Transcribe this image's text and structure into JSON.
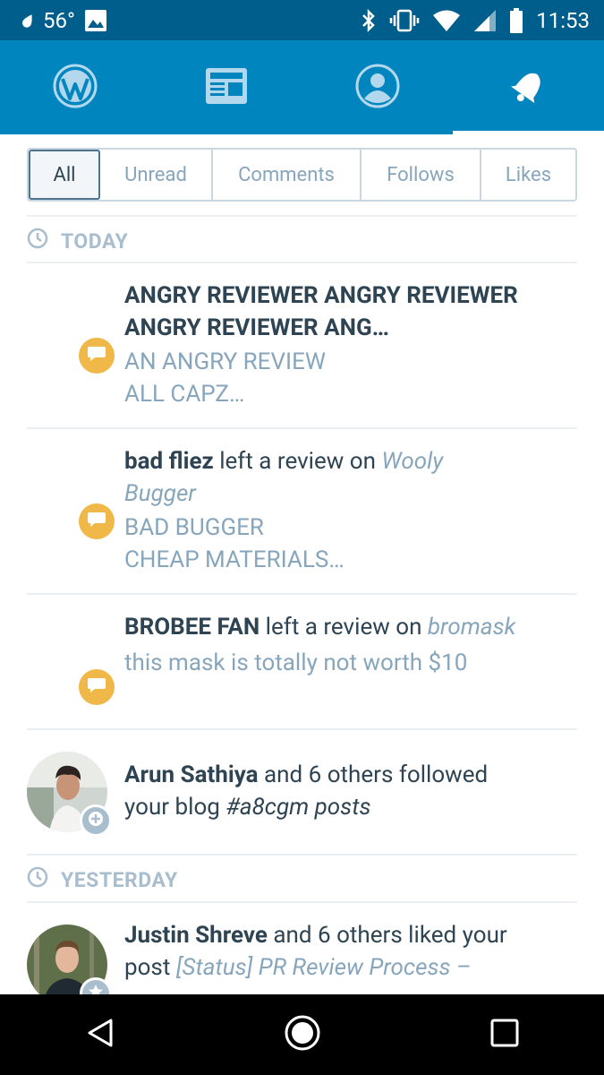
{
  "status_bar": {
    "temperature": "56°",
    "time": "11:53",
    "icons": [
      "drop-icon",
      "image-icon",
      "bluetooth-icon",
      "vibrate-icon",
      "wifi-icon",
      "signal-icon",
      "battery-icon"
    ]
  },
  "top_nav": {
    "tabs": [
      {
        "icon": "wordpress-icon",
        "active": false
      },
      {
        "icon": "reader-icon",
        "active": false
      },
      {
        "icon": "profile-icon",
        "active": false
      },
      {
        "icon": "notifications-bell-icon",
        "active": true
      }
    ]
  },
  "filters": {
    "items": [
      "All",
      "Unread",
      "Comments",
      "Follows",
      "Likes"
    ],
    "selected": "All"
  },
  "sections": {
    "today": "TODAY",
    "yesterday": "YESTERDAY"
  },
  "notifications": [
    {
      "title": "ANGRY REVIEWER ANGRY REVIEWER ANGRY REVIEWER ANG…",
      "excerpt_line1": "AN ANGRY REVIEW",
      "excerpt_line2": "ALL CAPZ…"
    },
    {
      "actor": "bad fliez",
      "action": "left a review on",
      "target_line1": "Wooly",
      "target_line2": "Bugger",
      "excerpt_line1": "BAD BUGGER",
      "excerpt_line2": "CHEAP MATERIALS…"
    },
    {
      "actor": "BROBEE FAN",
      "action": "left a review on",
      "target": "bromask",
      "excerpt": "this mask is totally not worth $10"
    },
    {
      "actor": "Arun Sathiya",
      "action_line1": "and 6 others followed",
      "action_line2": "your blog",
      "target": "#a8cgm posts"
    },
    {
      "actor": "Justin Shreve",
      "action_line1": "and 6 others liked your",
      "action_line2": "post",
      "target": "[Status] PR Review Process –"
    }
  ],
  "colors": {
    "status_bar": "#005e8c",
    "app_bar": "#0085be",
    "comment_badge": "#f0b849",
    "text_dark": "#2e4453",
    "text_muted": "#87a6bc"
  }
}
